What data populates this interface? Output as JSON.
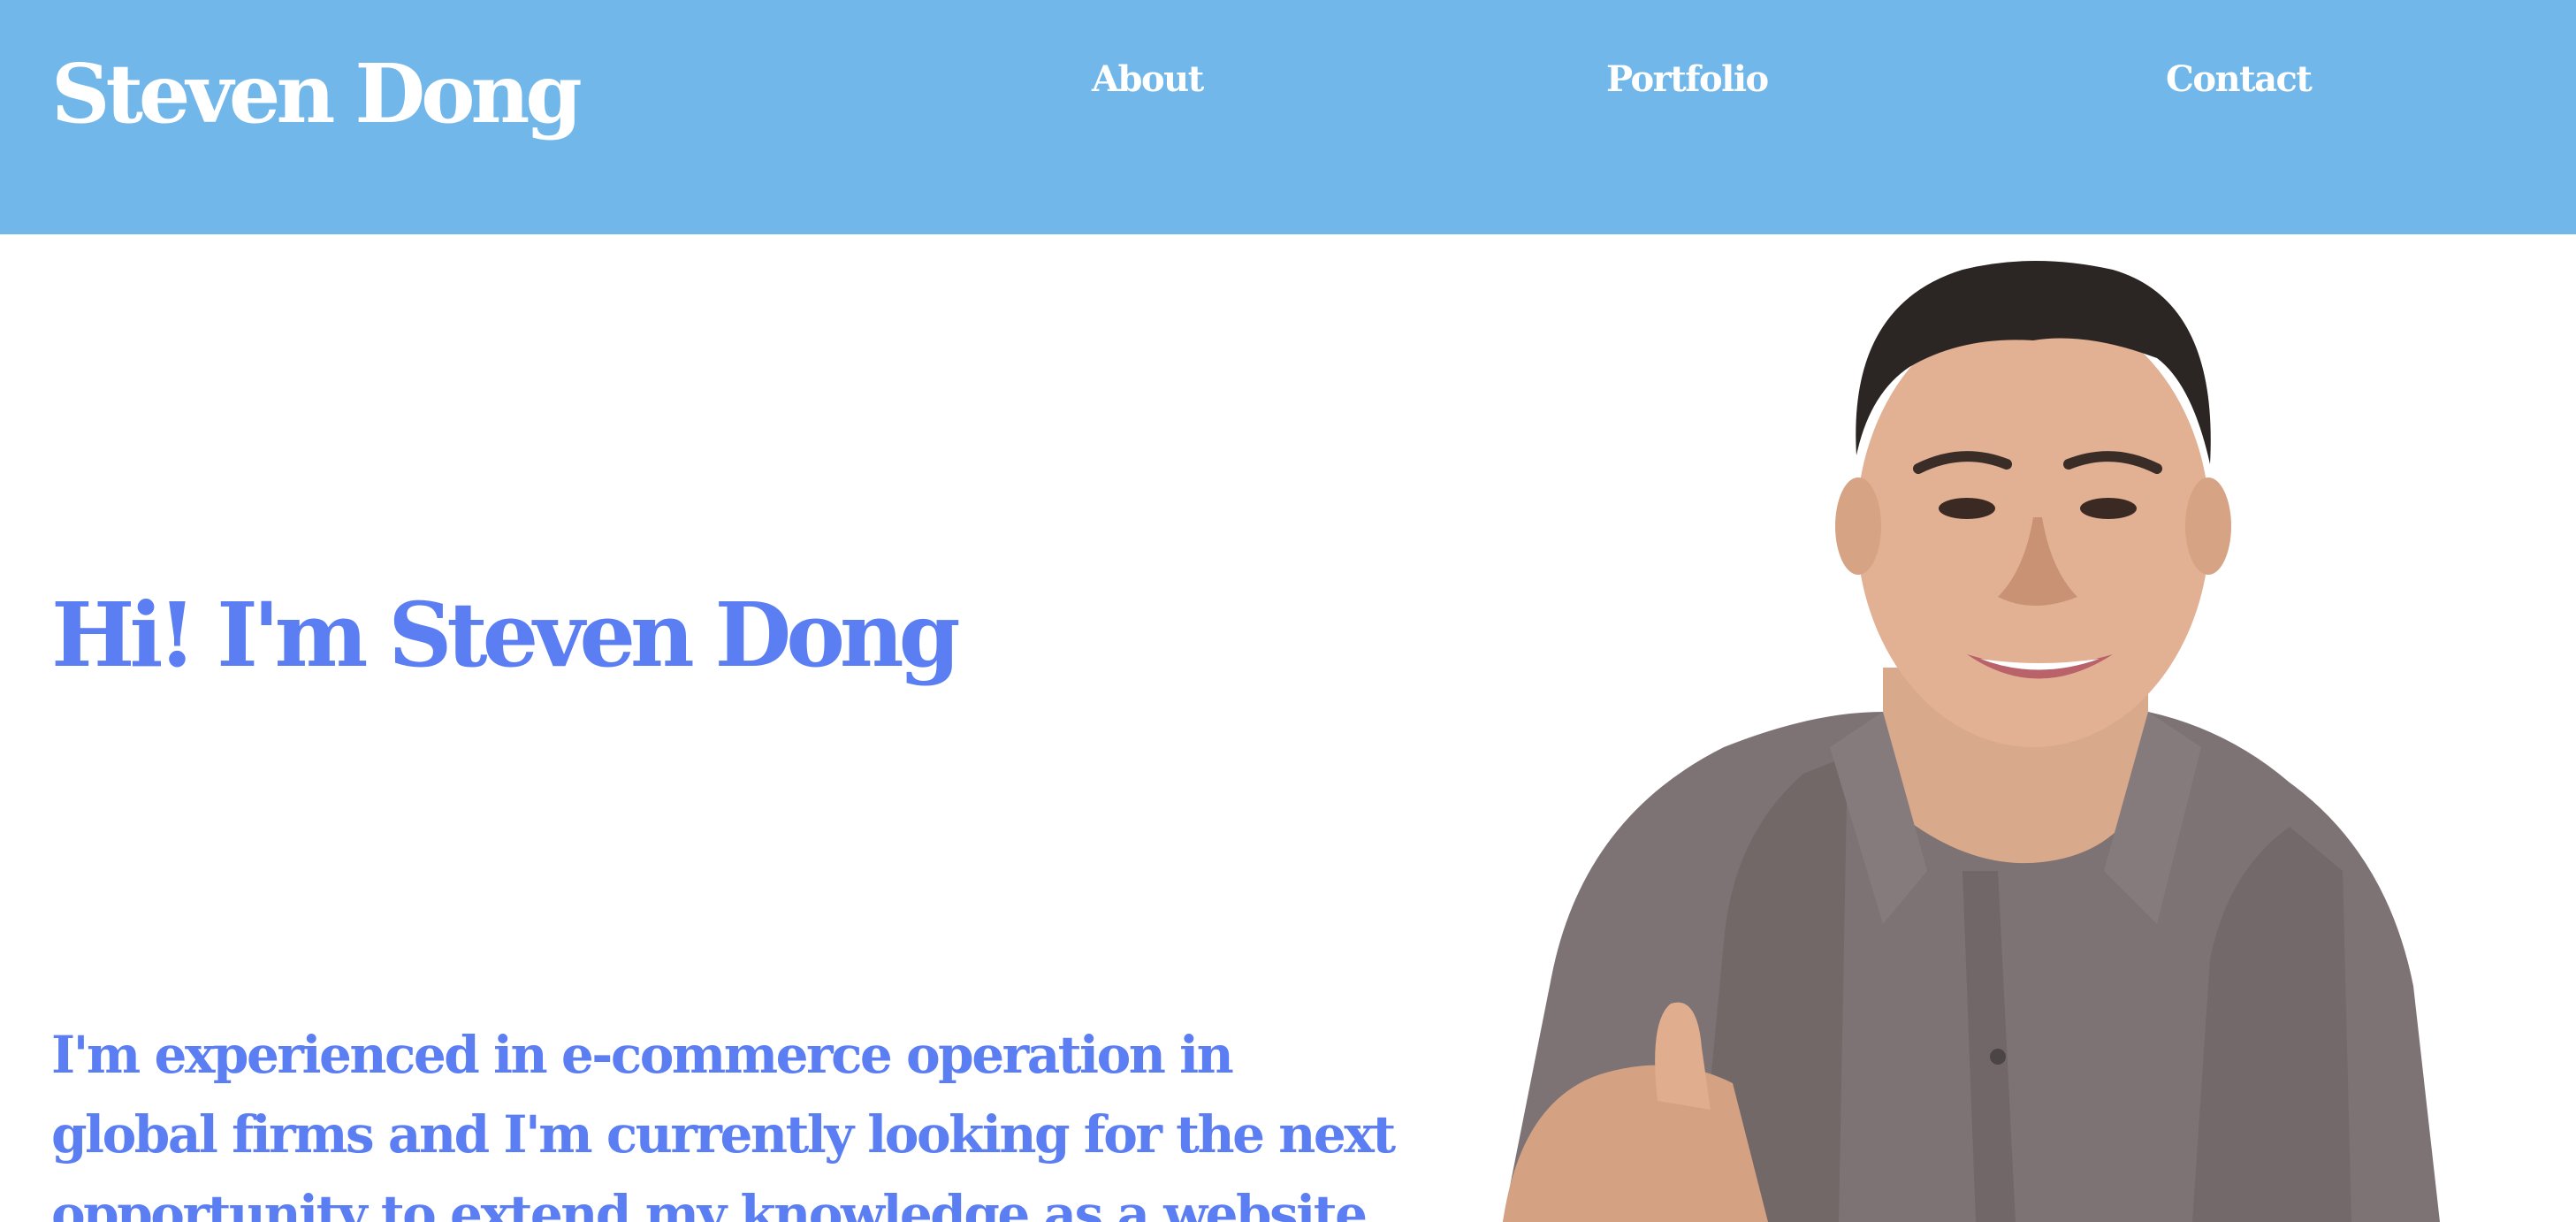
{
  "header": {
    "brand": "Steven Dong",
    "nav": [
      {
        "label": "About"
      },
      {
        "label": "Portfolio"
      },
      {
        "label": "Contact"
      }
    ],
    "background_color": "#72b7ea"
  },
  "hero": {
    "title": "Hi! I'm Steven Dong",
    "intro": "I'm experienced in e-commerce operation in global firms and I'm currently looking for the next opportunity to extend my knowledge as a website",
    "text_color": "#5b7ef2"
  },
  "portrait": {
    "icon": "person-photo"
  }
}
